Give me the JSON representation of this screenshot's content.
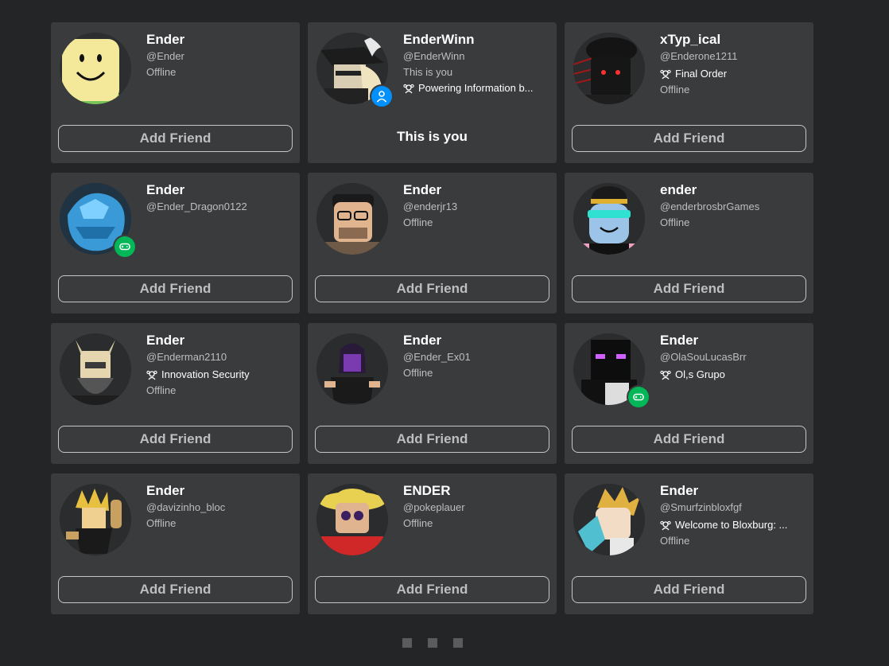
{
  "cards": [
    {
      "name": "Ender",
      "handle": "@Ender",
      "status": "Offline",
      "button": "Add Friend",
      "avatar": "noob-face-avatar"
    },
    {
      "name": "EnderWinn",
      "handle": "@EnderWinn",
      "you_line": "This is you",
      "group": "Powering Information b...",
      "you_label": "This is you",
      "avatar": "pirate-hat-avatar"
    },
    {
      "name": "xTyp_ical",
      "handle": "@Enderone1211",
      "group": "Final Order",
      "status": "Offline",
      "button": "Add Friend",
      "avatar": "black-mask-avatar"
    },
    {
      "name": "Ender",
      "handle": "@Ender_Dragon0122",
      "button": "Add Friend",
      "avatar": "blue-dragon-avatar"
    },
    {
      "name": "Ender",
      "handle": "@enderjr13",
      "status": "Offline",
      "button": "Add Friend",
      "avatar": "glasses-beard-avatar"
    },
    {
      "name": "ender",
      "handle": "@enderbrosbrGames",
      "status": "Offline",
      "button": "Add Friend",
      "avatar": "visor-avatar"
    },
    {
      "name": "Ender",
      "handle": "@Enderman2110",
      "group": "Innovation Security",
      "status": "Offline",
      "button": "Add Friend",
      "avatar": "horned-helmet-avatar"
    },
    {
      "name": "Ender",
      "handle": "@Ender_Ex01",
      "status": "Offline",
      "button": "Add Friend",
      "avatar": "purple-hood-avatar"
    },
    {
      "name": "Ender",
      "handle": "@OlaSouLucasBrr",
      "group": "Ol,s Grupo",
      "button": "Add Friend",
      "avatar": "enderman-avatar"
    },
    {
      "name": "Ender",
      "handle": "@davizinho_bloc",
      "status": "Offline",
      "button": "Add Friend",
      "avatar": "golden-hair-avatar"
    },
    {
      "name": "ENDER",
      "handle": "@pokeplauer",
      "status": "Offline",
      "button": "Add Friend",
      "avatar": "straw-hat-avatar"
    },
    {
      "name": "Ender",
      "handle": "@Smurfzinbloxfgf",
      "group": "Welcome to Bloxburg: ...",
      "status": "Offline",
      "button": "Add Friend",
      "avatar": "blonde-anime-avatar"
    }
  ],
  "colors": {
    "background": "#232527",
    "card": "#393b3d",
    "game_badge": "#02b757",
    "you_badge": "#0091ff"
  }
}
